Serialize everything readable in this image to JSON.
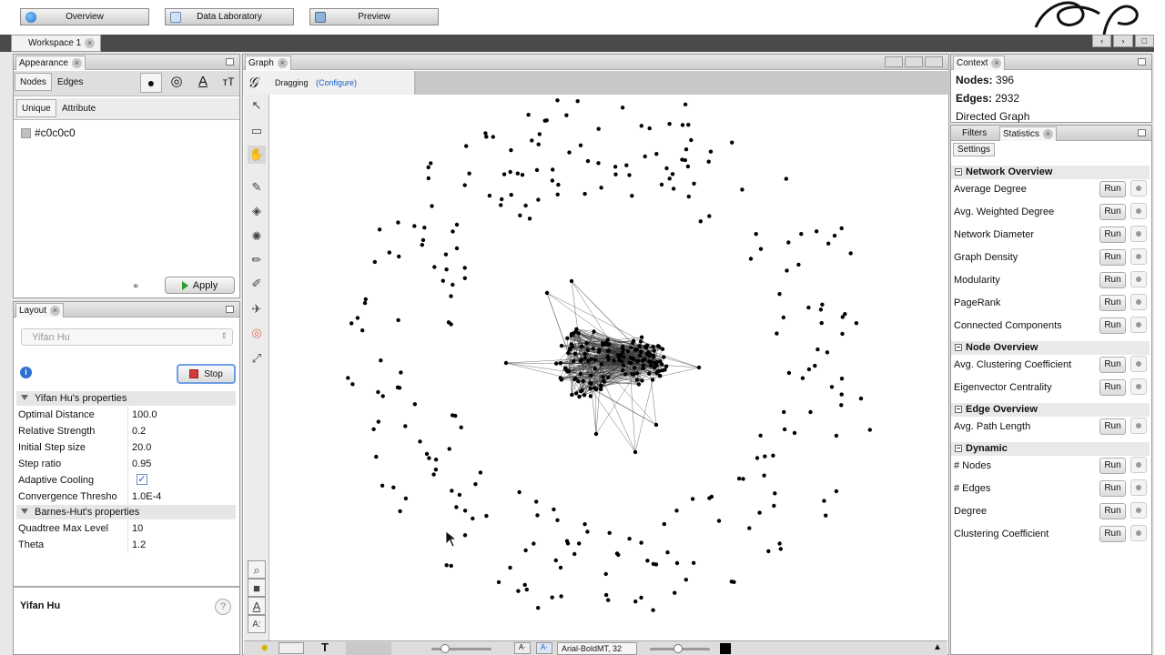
{
  "modes": [
    {
      "label": "Overview"
    },
    {
      "label": "Data Laboratory"
    },
    {
      "label": "Preview"
    }
  ],
  "workspace_tab": "Workspace 1",
  "appearance": {
    "title": "Appearance",
    "tabs": [
      "Nodes",
      "Edges"
    ],
    "subtabs": [
      "Unique",
      "Attribute"
    ],
    "color_value": "#c0c0c0",
    "apply_label": "Apply"
  },
  "layout": {
    "title": "Layout",
    "algorithm": "Yifan Hu",
    "stop_label": "Stop",
    "section1": "Yifan Hu's properties",
    "props1": [
      {
        "key": "Optimal Distance",
        "value": "100.0"
      },
      {
        "key": "Relative Strength",
        "value": "0.2"
      },
      {
        "key": "Initial Step size",
        "value": "20.0"
      },
      {
        "key": "Step ratio",
        "value": "0.95"
      },
      {
        "key": "Adaptive Cooling",
        "value": ""
      },
      {
        "key": "Convergence Thresho",
        "value": "1.0E-4"
      }
    ],
    "section2": "Barnes-Hut's properties",
    "props2": [
      {
        "key": "Quadtree Max Level",
        "value": "10"
      },
      {
        "key": "Theta",
        "value": "1.2"
      }
    ],
    "footer_title": "Yifan Hu"
  },
  "graph": {
    "title": "Graph",
    "mode_label": "Dragging",
    "configure_label": "(Configure)",
    "font_label": "Arial-BoldMT, 32"
  },
  "context": {
    "title": "Context",
    "nodes_label": "Nodes:",
    "nodes_value": "396",
    "edges_label": "Edges:",
    "edges_value": "2932",
    "type": "Directed Graph"
  },
  "stats_panel": {
    "tabs": [
      "Filters",
      "Statistics"
    ],
    "settings_label": "Settings",
    "run_label": "Run",
    "sections": [
      {
        "title": "Network Overview",
        "items": [
          "Average Degree",
          "Avg. Weighted Degree",
          "Network Diameter",
          "Graph Density",
          "Modularity",
          "PageRank",
          "Connected Components"
        ]
      },
      {
        "title": "Node Overview",
        "items": [
          "Avg. Clustering Coefficient",
          "Eigenvector Centrality"
        ]
      },
      {
        "title": "Edge Overview",
        "items": [
          "Avg. Path Length"
        ]
      },
      {
        "title": "Dynamic",
        "items": [
          "# Nodes",
          "# Edges",
          "Degree",
          "Clustering Coefficient"
        ]
      }
    ]
  },
  "colors": {
    "accent_link": "#1c5ec8",
    "stop_red": "#d63a3a",
    "apply_green": "#2e9a2e"
  },
  "icons": [
    "globe-icon",
    "table-icon",
    "monitor-icon",
    "palette-icon",
    "info-icon",
    "help-icon"
  ]
}
